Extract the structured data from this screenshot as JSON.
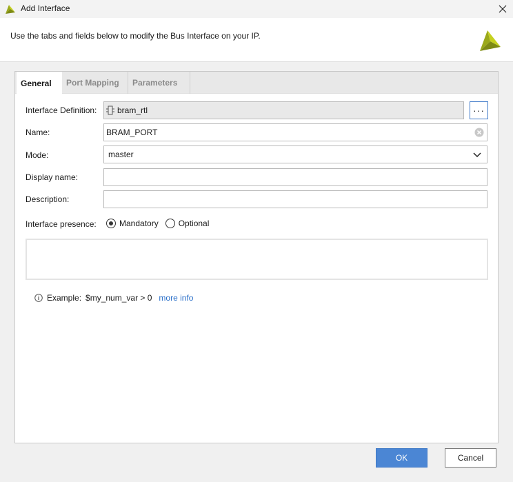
{
  "window": {
    "title": "Add Interface"
  },
  "header": {
    "instructions": "Use the tabs and fields below to modify the Bus Interface on your IP."
  },
  "tabs": [
    {
      "label": "General",
      "active": true
    },
    {
      "label": "Port Mapping",
      "active": false
    },
    {
      "label": "Parameters",
      "active": false
    }
  ],
  "form": {
    "interface_definition": {
      "label": "Interface Definition:",
      "value": "bram_rtl",
      "browse_label": "···"
    },
    "name": {
      "label": "Name:",
      "value": "BRAM_PORT"
    },
    "mode": {
      "label": "Mode:",
      "value": "master"
    },
    "display_name": {
      "label": "Display name:",
      "value": ""
    },
    "description": {
      "label": "Description:",
      "value": ""
    },
    "presence": {
      "label": "Interface presence:",
      "options": [
        "Mandatory",
        "Optional"
      ],
      "selected": "Mandatory"
    },
    "example": {
      "prefix": "Example:",
      "value": "$my_num_var > 0",
      "link": "more info"
    }
  },
  "buttons": {
    "ok": "OK",
    "cancel": "Cancel"
  },
  "colors": {
    "accent": "#4b86d4",
    "logo": "#b5c41e",
    "link": "#2a6fc9"
  }
}
